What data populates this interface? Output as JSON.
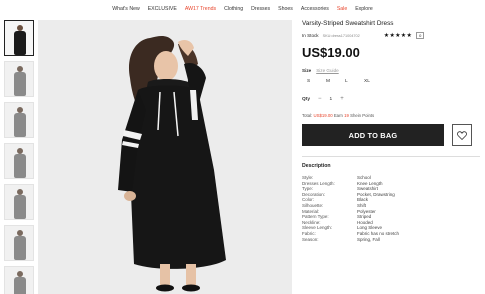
{
  "nav": {
    "items": [
      {
        "label": "What's New",
        "hot": false
      },
      {
        "label": "EXCLUSIVE",
        "hot": false
      },
      {
        "label": "AW17 Trends",
        "hot": true
      },
      {
        "label": "Clothing",
        "hot": false
      },
      {
        "label": "Dresses",
        "hot": false
      },
      {
        "label": "Shoes",
        "hot": false
      },
      {
        "label": "Accessories",
        "hot": false
      },
      {
        "label": "Sale",
        "hot": true
      },
      {
        "label": "Explore",
        "hot": false
      }
    ]
  },
  "thumbnails": [
    {
      "style": "dark"
    },
    {
      "style": "grey"
    },
    {
      "style": "grey"
    },
    {
      "style": "grey"
    },
    {
      "style": "grey"
    },
    {
      "style": "grey"
    },
    {
      "style": "grey"
    }
  ],
  "product": {
    "title": "Varsity-Striped Sweatshirt Dress",
    "stock": "In Stock",
    "sku": "SKU:dress171004702",
    "stars": "★★★★★",
    "review_count": "0",
    "price": "US$19.00",
    "size_label": "Size",
    "size_guide": "Size Guide",
    "sizes": [
      "S",
      "M",
      "L",
      "XL"
    ],
    "qty_label": "Qty",
    "qty_minus": "−",
    "qty_value": "1",
    "qty_plus": "+",
    "points_total_label": "Total:",
    "points_total_price": "US$19.00",
    "points_earn_label": "Earn",
    "points_value": "19",
    "points_suffix": "Shein Points",
    "add_to_bag": "ADD TO BAG"
  },
  "description": {
    "title": "Description",
    "attributes": [
      {
        "k": "Style:",
        "v": "School"
      },
      {
        "k": "Dresses Length:",
        "v": "Knee Length"
      },
      {
        "k": "Type:",
        "v": "Sweatshirt"
      },
      {
        "k": "Decoration:",
        "v": "Pocket, Drawstring"
      },
      {
        "k": "Color:",
        "v": "Black"
      },
      {
        "k": "Silhouette:",
        "v": "Shift"
      },
      {
        "k": "Material:",
        "v": "Polyester"
      },
      {
        "k": "Pattern Type:",
        "v": "Striped"
      },
      {
        "k": "Neckline:",
        "v": "Hooded"
      },
      {
        "k": "Sleeve Length:",
        "v": "Long Sleeve"
      },
      {
        "k": "Fabric:",
        "v": "Fabric has no stretch"
      },
      {
        "k": "Season:",
        "v": "Spring, Fall"
      }
    ]
  },
  "colors": {
    "accent": "#e8452c",
    "button": "#222222"
  }
}
